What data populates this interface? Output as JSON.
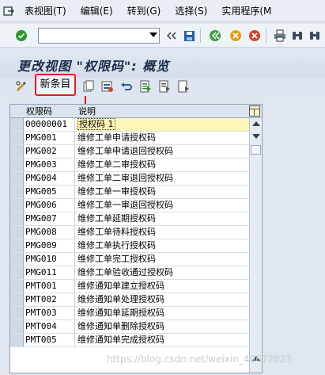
{
  "menubar": {
    "items": [
      "表视图(T)",
      "编辑(E)",
      "转到(G)",
      "选择(S)",
      "实用程序(M"
    ]
  },
  "toolbar": {
    "command_value": ""
  },
  "title": "更改视图 \"权限码\": 概览",
  "app_toolbar": {
    "new_entry_label": "新条目"
  },
  "table": {
    "headers": [
      "权限码",
      "说明"
    ],
    "rows": [
      {
        "code": "00000001",
        "desc": "授权码 1"
      },
      {
        "code": "PMG001",
        "desc": "维修工单申请授权码"
      },
      {
        "code": "PMG002",
        "desc": "维修工单申请退回授权码"
      },
      {
        "code": "PMG003",
        "desc": "维修工单二审授权码"
      },
      {
        "code": "PMG004",
        "desc": "维修工单二审退回授权码"
      },
      {
        "code": "PMG005",
        "desc": "维修工单一审授权码"
      },
      {
        "code": "PMG006",
        "desc": "维修工单一审退回授权码"
      },
      {
        "code": "PMG007",
        "desc": "维修工单延期授权码"
      },
      {
        "code": "PMG008",
        "desc": "维修工单待料授权码"
      },
      {
        "code": "PMG009",
        "desc": "维修工单执行授权码"
      },
      {
        "code": "PMG010",
        "desc": "维修工单完工授权码"
      },
      {
        "code": "PMG011",
        "desc": "维修工单验收通过授权码"
      },
      {
        "code": "PMT001",
        "desc": "维修通知单建立授权码"
      },
      {
        "code": "PMT002",
        "desc": "维修通知单处理授权码"
      },
      {
        "code": "PMT003",
        "desc": "维修通知单延期授权码"
      },
      {
        "code": "PMT004",
        "desc": "维修通知单删除授权码"
      },
      {
        "code": "PMT005",
        "desc": "维修通知单完成授权码"
      }
    ]
  },
  "watermark": "https://blog.csdn.net/weixin_40672823",
  "colors": {
    "highlight_box": "#e11d1d",
    "selected_cell": "#fff7b8",
    "title_text": "#1b2c4a"
  }
}
